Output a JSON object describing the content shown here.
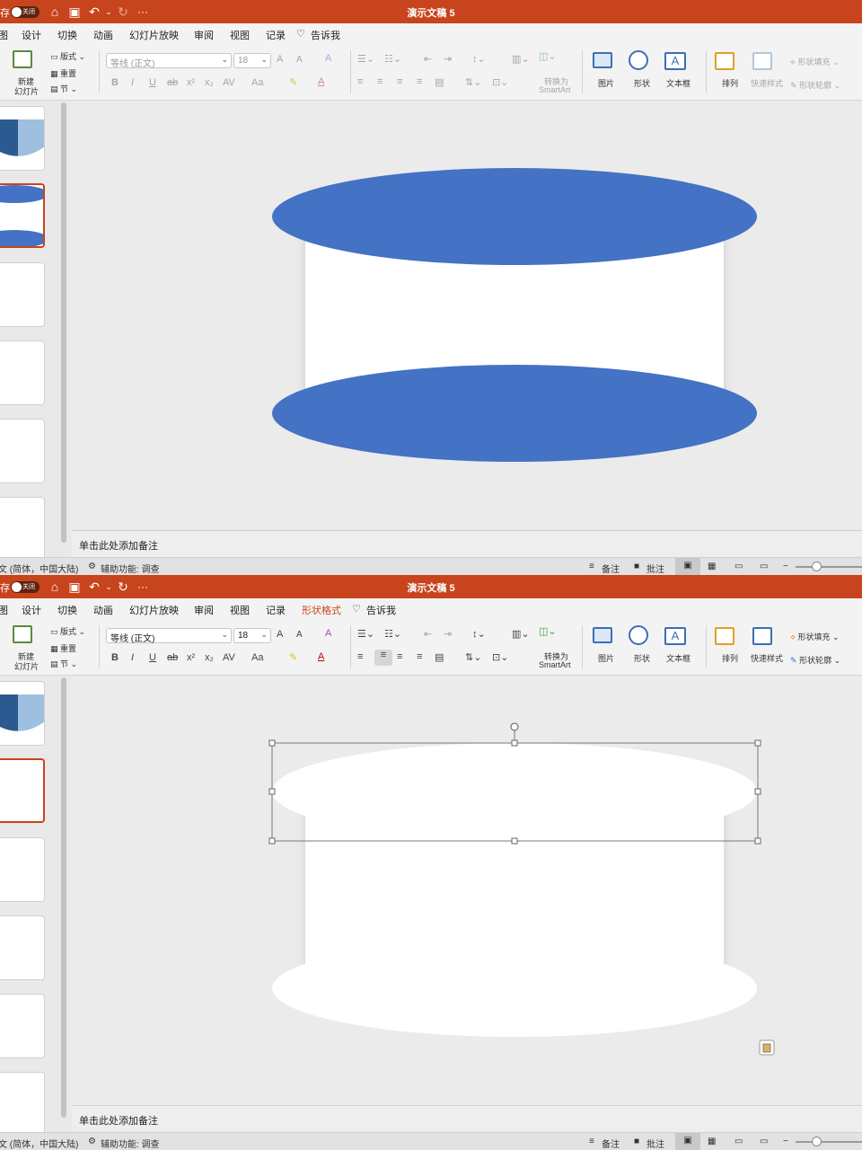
{
  "app": {
    "title": "演示文稿 5",
    "autosave_label": "存",
    "autosave_toggle": "关闭",
    "more": "···"
  },
  "menu": {
    "items": [
      "图",
      "设计",
      "切换",
      "动画",
      "幻灯片放映",
      "审阅",
      "视图",
      "记录"
    ],
    "shape_format": "形状格式",
    "tell_me": "告诉我"
  },
  "ribbon": {
    "new_slide": "新建\n幻灯片",
    "new_slide_line1": "新建",
    "new_slide_line2": "幻灯片",
    "layout": "版式",
    "reset": "重置",
    "section": "节",
    "font_name": "等线 (正文)",
    "font_size": "18",
    "grow_font": "A",
    "shrink_font": "A",
    "bold": "B",
    "italic": "I",
    "underline": "U",
    "strike": "ab",
    "superscript": "x²",
    "subscript": "x₂",
    "char_spacing": "AV",
    "change_case": "Aa",
    "convert_smartart_1": "转换为",
    "convert_smartart_2": "SmartArt",
    "picture": "图片",
    "shapes": "形状",
    "textbox": "文本框",
    "arrange": "排列",
    "quick_styles": "快速样式",
    "shape_fill": "形状填充",
    "shape_outline": "形状轮廓"
  },
  "notes_placeholder": "单击此处添加备注",
  "status": {
    "language": "文 (简体，中国大陆)",
    "accessibility": "辅助功能: 调查",
    "notes": "备注",
    "comments": "批注"
  },
  "colors": {
    "title_bar": "#c8441d",
    "ellipse_blue": "#4472c4",
    "selection_accent": "#c8441d"
  }
}
